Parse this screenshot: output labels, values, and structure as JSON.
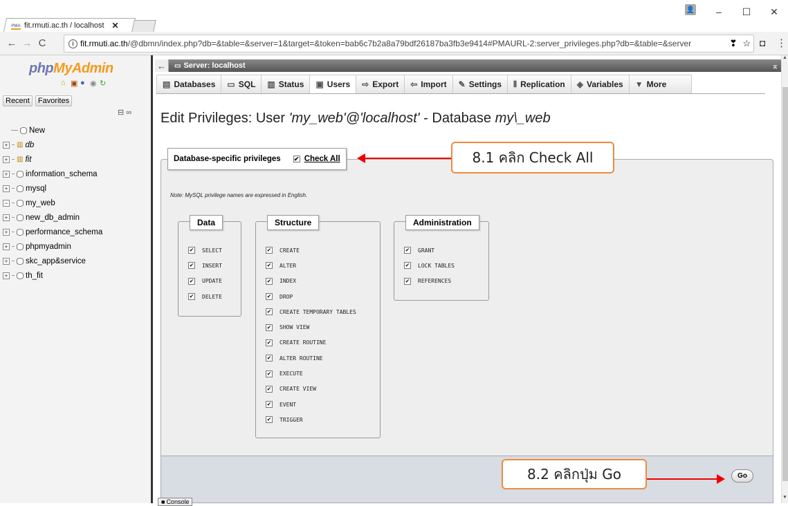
{
  "browser": {
    "tab_title": "fit.rmuti.ac.th / localhost",
    "tab_favicon_text": "PMA",
    "tab_close": "✕",
    "url_host": "fit.rmuti.ac.th",
    "url_path": "/@dbmn/index.php?db=&table=&server=1&target=&token=bab6c7b2a8a79bdf26187ba3fb3e9414#PMAURL-2:server_privileges.php?db=&table=&server",
    "window_controls": [
      "–",
      "☐",
      "✕"
    ]
  },
  "nav": {
    "logo_php": "php",
    "logo_myadmin": "MyAdmin",
    "recent_label": "Recent",
    "favorites_label": "Favorites",
    "tree": [
      {
        "label": "New",
        "type": "new"
      },
      {
        "label": "db",
        "type": "db-italic",
        "expander": "+"
      },
      {
        "label": "fit",
        "type": "db-italic",
        "expander": "+"
      },
      {
        "label": "information_schema",
        "type": "db",
        "expander": "+"
      },
      {
        "label": "mysql",
        "type": "db",
        "expander": "+"
      },
      {
        "label": "my_web",
        "type": "db",
        "expander": "−"
      },
      {
        "label": "new_db_admin",
        "type": "db",
        "expander": "+"
      },
      {
        "label": "performance_schema",
        "type": "db",
        "expander": "+"
      },
      {
        "label": "phpmyadmin",
        "type": "db",
        "expander": "+"
      },
      {
        "label": "skc_app&service",
        "type": "db",
        "expander": "+"
      },
      {
        "label": "th_fit",
        "type": "db",
        "expander": "+"
      }
    ]
  },
  "main": {
    "server_label": "Server: localhost",
    "tabs": [
      {
        "label": "Databases",
        "icon": "database-icon",
        "glyph": "▤"
      },
      {
        "label": "SQL",
        "icon": "sql-icon",
        "glyph": "▭"
      },
      {
        "label": "Status",
        "icon": "status-icon",
        "glyph": "▥"
      },
      {
        "label": "Users",
        "icon": "users-icon",
        "glyph": "▣"
      },
      {
        "label": "Export",
        "icon": "export-icon",
        "glyph": "⇨"
      },
      {
        "label": "Import",
        "icon": "import-icon",
        "glyph": "⇦"
      },
      {
        "label": "Settings",
        "icon": "wrench-icon",
        "glyph": "✎"
      },
      {
        "label": "Replication",
        "icon": "replication-icon",
        "glyph": "⫴"
      },
      {
        "label": "Variables",
        "icon": "variables-icon",
        "glyph": "◈"
      },
      {
        "label": "More",
        "icon": "chevron-down-icon",
        "glyph": "▼"
      }
    ],
    "title_prefix": "Edit Privileges: User ",
    "title_user": "'my_web'@'localhost'",
    "title_mid": " - Database ",
    "title_db": "my\\_web",
    "legend_label": "Database-specific privileges",
    "check_all_label": "Check All",
    "note": "Note: MySQL privilege names are expressed in English.",
    "groups": {
      "data": {
        "title": "Data",
        "items": [
          "SELECT",
          "INSERT",
          "UPDATE",
          "DELETE"
        ]
      },
      "structure": {
        "title": "Structure",
        "items": [
          "CREATE",
          "ALTER",
          "INDEX",
          "DROP",
          "CREATE TEMPORARY TABLES",
          "SHOW VIEW",
          "CREATE ROUTINE",
          "ALTER ROUTINE",
          "EXECUTE",
          "CREATE VIEW",
          "EVENT",
          "TRIGGER"
        ]
      },
      "administration": {
        "title": "Administration",
        "items": [
          "GRANT",
          "LOCK TABLES",
          "REFERENCES"
        ]
      }
    },
    "go_label": "Go",
    "console_label": "Console"
  },
  "annotations": {
    "step1": "8.1 คลิก Check All",
    "step2": "8.2 คลิกปุ่ม Go",
    "color_box": "#f08a3c",
    "color_arrow": "#e00000"
  }
}
